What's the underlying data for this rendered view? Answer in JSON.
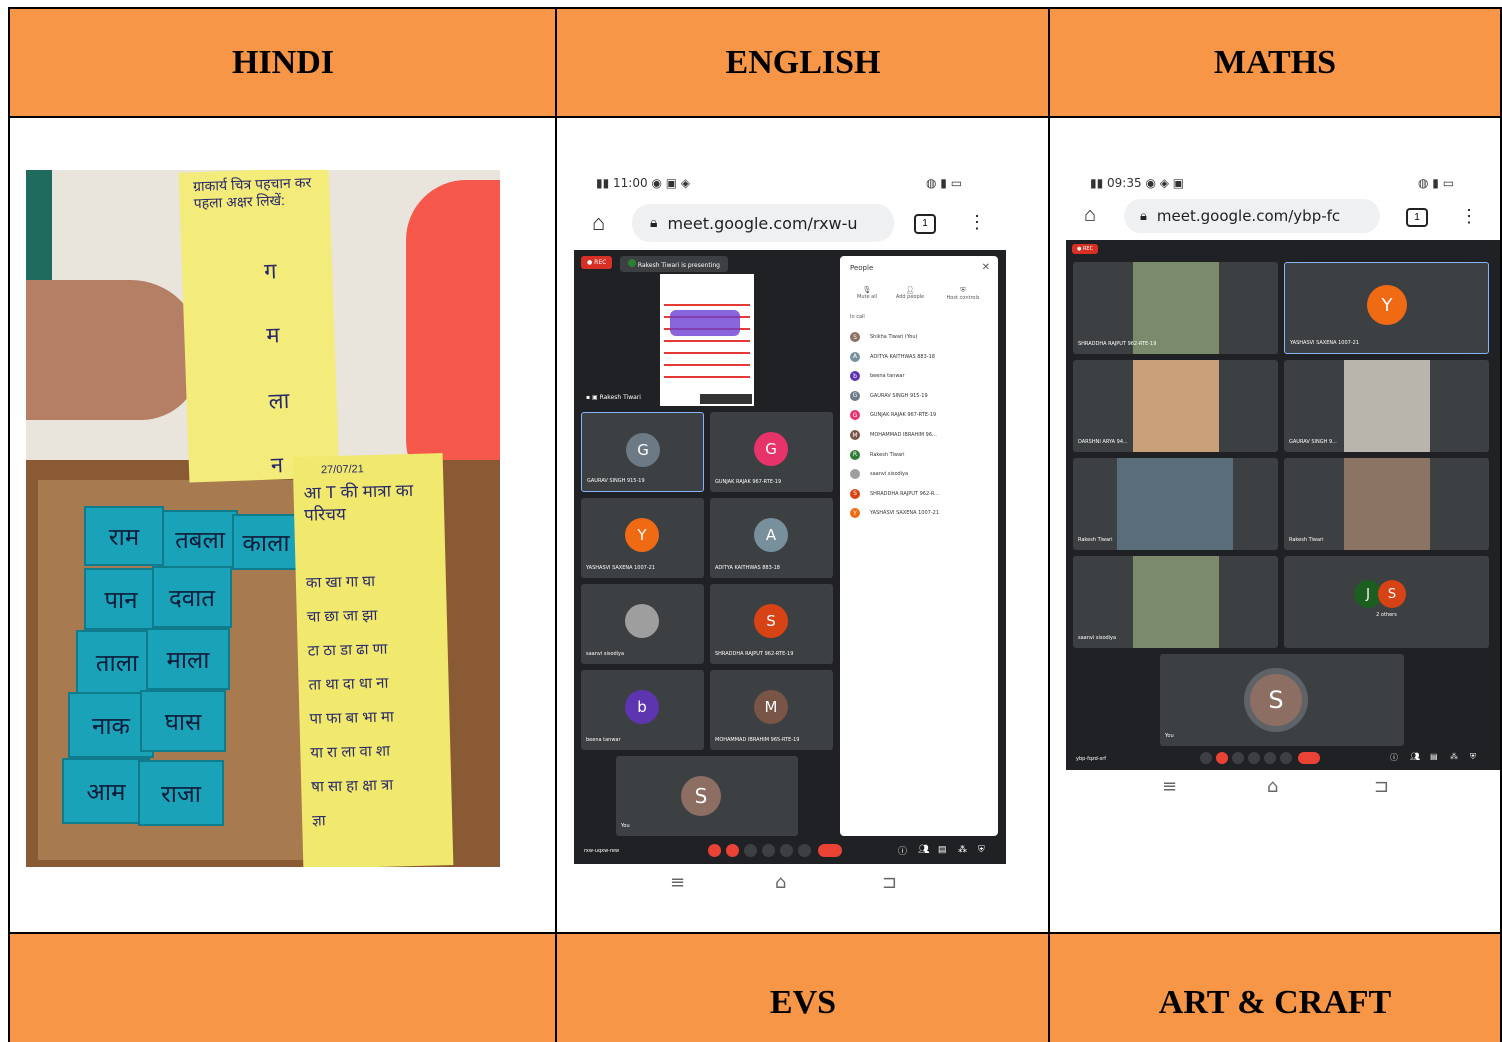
{
  "table": {
    "headers": [
      "HINDI",
      "ENGLISH",
      "MATHS"
    ],
    "footers": [
      "",
      "EVS",
      "ART & CRAFT"
    ]
  },
  "hindi_photo": {
    "card_top_title": "ग्राकार्य चित्र पहचान कर पहला अक्षर लिखें:",
    "card_top_answers": [
      "ग",
      "म",
      "ला",
      "न"
    ],
    "card_bottom_date": "27/07/21",
    "card_bottom_title": "आ T की मात्रा का परिचय",
    "card_bottom_lines": [
      "का खा गा घा",
      "चा छा जा झा",
      "टा ठा डा ढा णा",
      "ता था दा धा ना",
      "पा फा बा भा मा",
      "या रा ला वा शा",
      "षा सा हा क्षा त्रा",
      "ज्ञा"
    ],
    "tiles": [
      "राम",
      "तबला",
      "काला",
      "पान",
      "दवात",
      "ताला",
      "माला",
      "नाक",
      "घास",
      "आम",
      "राजा"
    ]
  },
  "english_phone": {
    "time": "11:00",
    "url": "meet.google.com/rxw-u",
    "tab_count": "1",
    "rec": "REC",
    "presenting": "Rakesh Tiwari is presenting",
    "presenter": "Rakesh Tiwari",
    "tiles": [
      {
        "name": "GAURAV SINGH 915-19",
        "initial": "G",
        "color": "#6b7a85"
      },
      {
        "name": "GUNJAK RAJAK 967-RTE-19",
        "initial": "G",
        "color": "#e8336a"
      },
      {
        "name": "YASHASVI SAXENA 1007-21",
        "initial": "Y",
        "color": "#f06a14"
      },
      {
        "name": "ADITYA KAITHWAS 883-18",
        "initial": "A",
        "color": "#78909c"
      },
      {
        "name": "saanvi sisodiya",
        "initial": "",
        "color": "#9e9e9e"
      },
      {
        "name": "SHRADDHA RAJPUT 962-RTE-19",
        "initial": "S",
        "color": "#d84315"
      },
      {
        "name": "beena tanwar",
        "initial": "b",
        "color": "#5e35b1"
      },
      {
        "name": "MOHAMMAD IBRAHIM 965-RTE-19",
        "initial": "M",
        "color": "#795548"
      }
    ],
    "self_tile": {
      "name": "You",
      "initial": "S",
      "color": "#8d6e63"
    },
    "meeting_code": "rxw-uqxw-rew",
    "people_panel": {
      "title": "People",
      "actions": [
        "Mute all",
        "Add people",
        "Host controls"
      ],
      "section": "In call",
      "list": [
        {
          "name": "Shikha Tiwari (You)",
          "initial": "S",
          "color": "#8d6e63"
        },
        {
          "name": "ADITYA KAITHWAS 883-18",
          "initial": "A",
          "color": "#78909c"
        },
        {
          "name": "beena tanwar",
          "initial": "b",
          "color": "#5e35b1"
        },
        {
          "name": "GAURAV SINGH 915-19",
          "initial": "G",
          "color": "#6b7a85"
        },
        {
          "name": "GUNJAK RAJAK 967-RTE-19",
          "initial": "G",
          "color": "#e8336a"
        },
        {
          "name": "MOHAMMAD IBRAHIM 96...",
          "initial": "M",
          "color": "#795548"
        },
        {
          "name": "Rakesh Tiwari",
          "initial": "R",
          "color": "#2e7d32"
        },
        {
          "name": "saanvi sisodiya",
          "initial": "",
          "color": "#9e9e9e"
        },
        {
          "name": "SHRADDHA RAJPUT 962-R...",
          "initial": "S",
          "color": "#d84315"
        },
        {
          "name": "YASHASVI SAXENA 1007-21",
          "initial": "Y",
          "color": "#f06a14"
        }
      ]
    }
  },
  "maths_phone": {
    "time": "09:35",
    "url": "meet.google.com/ybp-fc",
    "tab_count": "1",
    "rec": "REC",
    "tiles": [
      {
        "name": "SHRADDHA RAJPUT 962-RTE-19"
      },
      {
        "name": "YASHASVI SAXENA 1007-21",
        "initial": "Y",
        "color": "#f06a14"
      },
      {
        "name": "DARSHNI ARYA 94..."
      },
      {
        "name": "GAURAV SINGH 9..."
      },
      {
        "name": "Rakesh Tiwari"
      },
      {
        "name": "Rakesh Tiwari"
      },
      {
        "name": "saanvi sisodiya"
      },
      {
        "name": "2 others",
        "initials": [
          "J",
          "S"
        ]
      }
    ],
    "self_tile": {
      "name": "You",
      "initial": "S",
      "color": "#8d6e63"
    },
    "meeting_code": "ybp-fqzd-srf"
  }
}
